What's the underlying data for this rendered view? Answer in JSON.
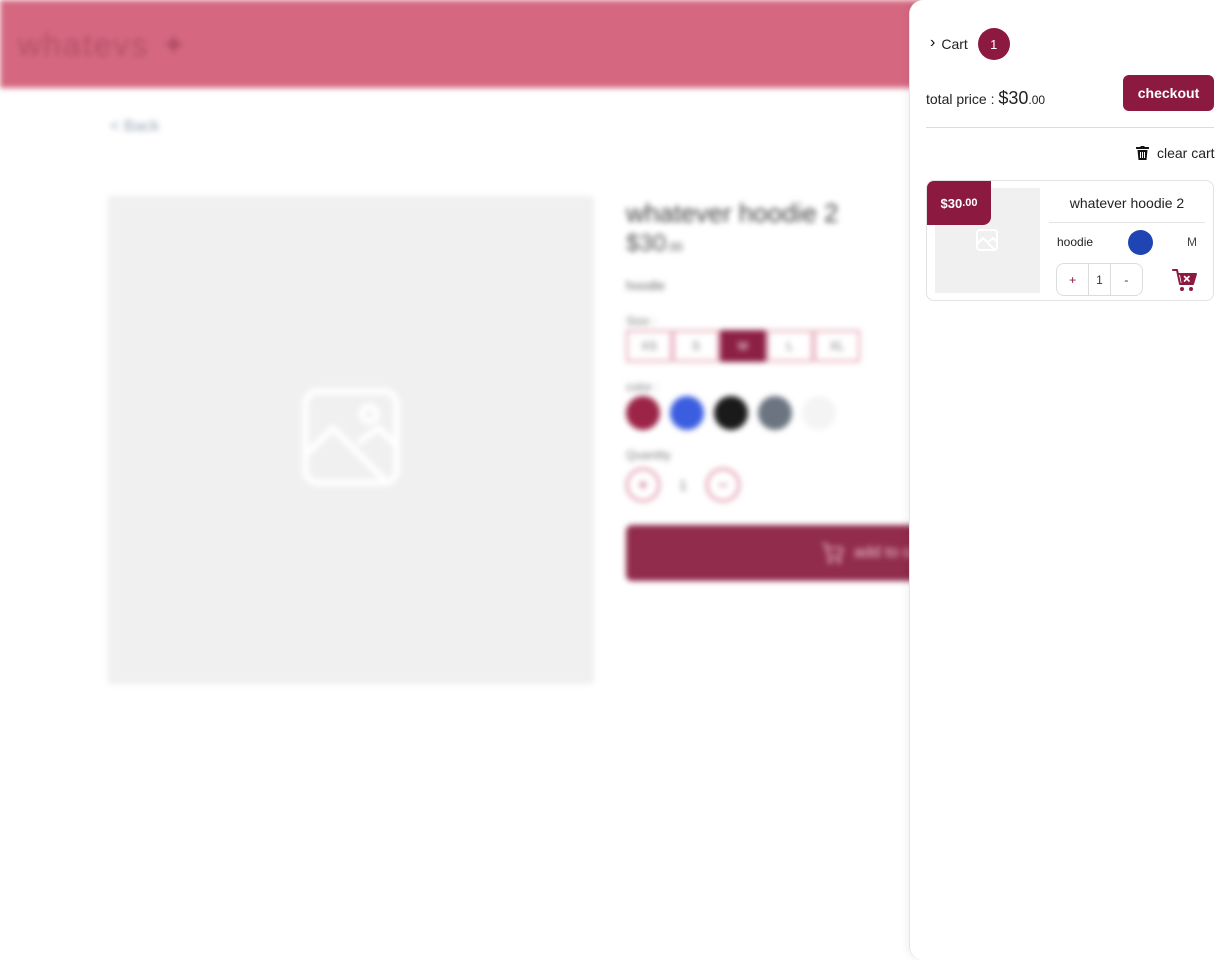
{
  "header": {
    "logo": "whatevs ✦"
  },
  "page": {
    "back_label": "< Back",
    "product_title": "whatever hoodie 2",
    "price_main": "$30",
    "price_cents": ".00",
    "category": "hoodie",
    "size_label": "Size :",
    "sizes": [
      "XS",
      "S",
      "M",
      "L",
      "XL"
    ],
    "selected_size": "M",
    "color_label": "color :",
    "colors": [
      "#9b2447",
      "#3b5ee0",
      "#1a1a1a",
      "#6b7480",
      "#f4f4f4"
    ],
    "quantity_label": "Quantity",
    "quantity": "1",
    "add_to_cart_label": "add to cart"
  },
  "cart": {
    "title": "Cart",
    "count": "1",
    "total_label": "total price : ",
    "total_main": "$30",
    "total_cents": ".00",
    "checkout_label": "checkout",
    "clear_label": "clear cart",
    "items": [
      {
        "price_main": "$30",
        "price_cents": ".00",
        "name": "whatever hoodie 2",
        "type": "hoodie",
        "color": "#1f45b5",
        "size": "M",
        "plus": "+",
        "quantity": "1",
        "minus": "-"
      }
    ]
  },
  "icons": {
    "collapse": "chevron-right-icon",
    "trash": "trash-icon",
    "remove": "cart-remove-icon",
    "image": "image-placeholder-icon"
  },
  "colors": {
    "accent": "#8c1a40",
    "header": "#d56880"
  }
}
